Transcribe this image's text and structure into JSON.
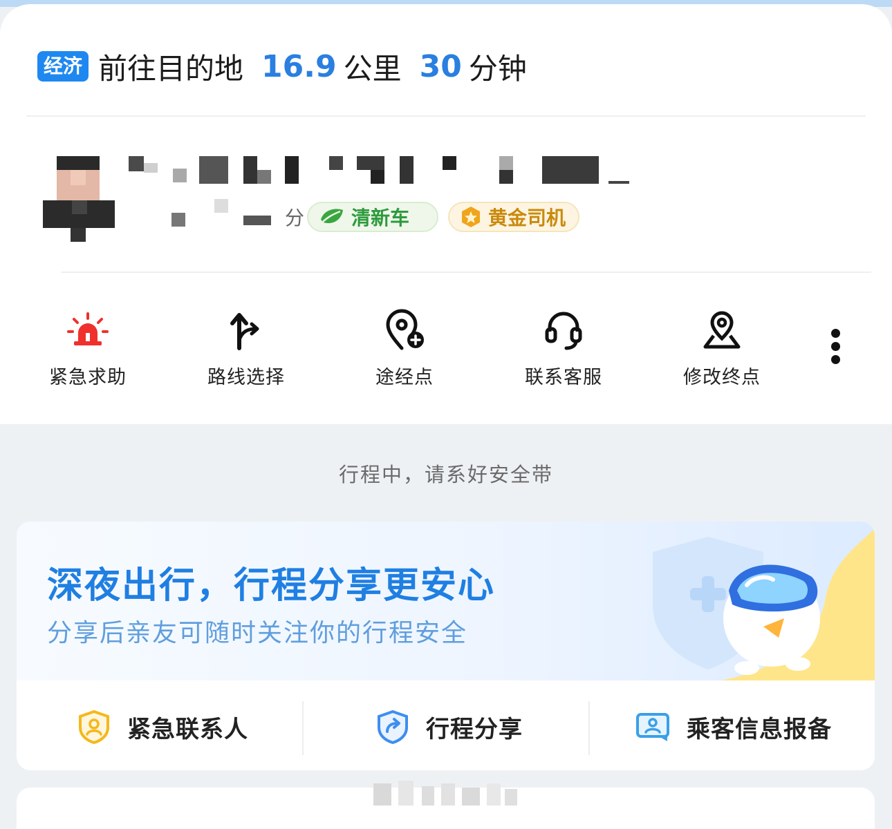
{
  "header": {
    "tag": "经济",
    "title": "前往目的地",
    "distance": "16.9",
    "distance_unit": "公里",
    "duration": "30",
    "duration_unit": "分钟"
  },
  "driver": {
    "rating_suffix": "分",
    "badges": [
      {
        "label": "清新车",
        "icon": "leaf-icon"
      },
      {
        "label": "黄金司机",
        "icon": "gold-medal-icon"
      }
    ]
  },
  "actions": [
    {
      "label": "紧急求助",
      "icon": "siren-icon"
    },
    {
      "label": "路线选择",
      "icon": "route-fork-icon"
    },
    {
      "label": "途经点",
      "icon": "add-waypoint-icon"
    },
    {
      "label": "联系客服",
      "icon": "headset-icon"
    },
    {
      "label": "修改终点",
      "icon": "edit-destination-icon"
    }
  ],
  "more_icon": "more-vertical-icon",
  "seatbelt_note": "行程中，请系好安全带",
  "safety": {
    "banner_title": "深夜出行，行程分享更安心",
    "banner_subtitle": "分享后亲友可随时关注你的行程安全",
    "items": [
      {
        "label": "紧急联系人",
        "icon": "emergency-contact-shield-icon"
      },
      {
        "label": "行程分享",
        "icon": "share-trip-shield-icon"
      },
      {
        "label": "乘客信息报备",
        "icon": "passenger-info-card-icon"
      }
    ]
  },
  "colors": {
    "accent_blue": "#2a7fe0",
    "tag_blue": "#1e88f0",
    "emergency_red": "#f0302c",
    "badge_green": "#2d9a3c",
    "badge_gold": "#c98a0c",
    "safety_yellow": "#f5b81b"
  }
}
